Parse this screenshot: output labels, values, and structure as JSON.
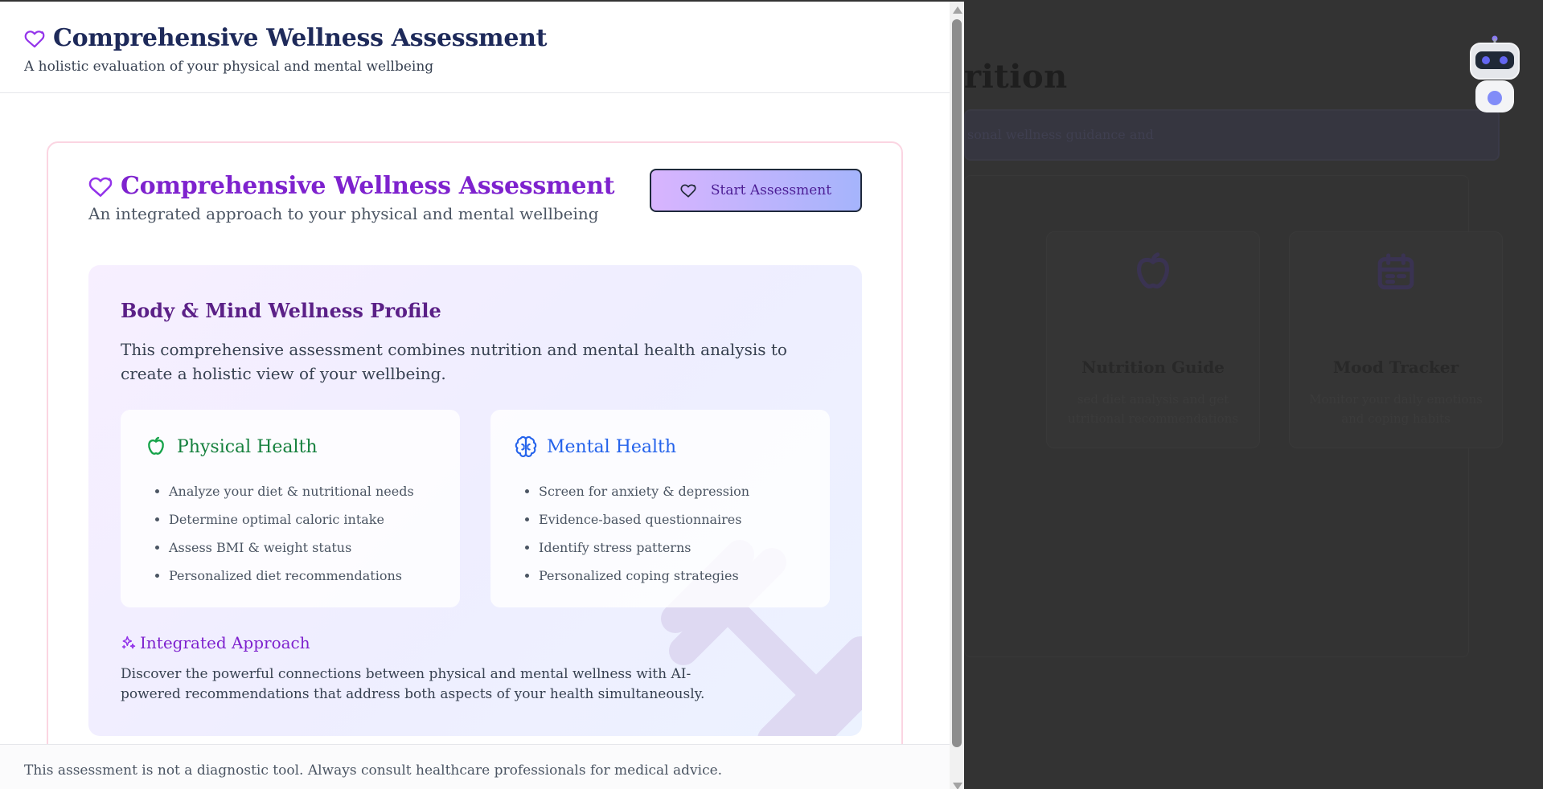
{
  "background_app": {
    "title_fragment": "rition",
    "banner_text": "sonal wellness guidance and",
    "cards": [
      {
        "icon": "apple-icon",
        "title": "Nutrition Guide",
        "description": "sed diet analysis and get utritional recommendations"
      },
      {
        "icon": "calendar-icon",
        "title": "Mood Tracker",
        "description": "Monitor your daily emotions and coping habits"
      }
    ],
    "assistant_icon": "robot-icon"
  },
  "modal": {
    "header": {
      "icon": "heart-icon",
      "title": "Comprehensive Wellness Assessment",
      "subtitle": "A holistic evaluation of your physical and mental wellbeing"
    },
    "card": {
      "icon": "heart-icon",
      "title": "Comprehensive Wellness Assessment",
      "subtitle": "An integrated approach to your physical and mental wellbeing",
      "start_button": {
        "icon": "heart-icon",
        "label": "Start Assessment"
      },
      "profile": {
        "title": "Body & Mind Wellness Profile",
        "description": "This comprehensive assessment combines nutrition and mental health analysis to create a holistic view of your wellbeing.",
        "physical": {
          "icon": "apple-icon",
          "title": "Physical Health",
          "items": [
            "Analyze your diet & nutritional needs",
            "Determine optimal caloric intake",
            "Assess BMI & weight status",
            "Personalized diet recommendations"
          ]
        },
        "mental": {
          "icon": "brain-icon",
          "title": "Mental Health",
          "items": [
            "Screen for anxiety & depression",
            "Evidence-based questionnaires",
            "Identify stress patterns",
            "Personalized coping strategies"
          ]
        },
        "integrated": {
          "icon": "sparkles-icon",
          "title": "Integrated Approach",
          "description": "Discover the powerful connections between physical and mental wellness with AI-powered recommendations that address both aspects of your health simultaneously."
        },
        "watermark_icon": "dumbbell-icon"
      }
    },
    "footer": {
      "disclaimer": "This assessment is not a diagnostic tool. Always consult healthcare professionals for medical advice."
    }
  },
  "colors": {
    "title_navy": "#1e2a5a",
    "accent_purple": "#7e22ce",
    "physical_green": "#15803d",
    "mental_blue": "#2563eb",
    "card_border_pink": "#fbd5e2",
    "overlay": "#333333"
  }
}
